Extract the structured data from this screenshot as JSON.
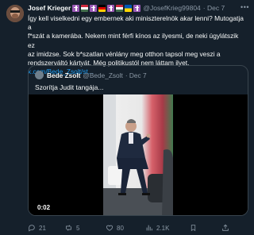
{
  "tweet": {
    "author_name": "Josef Krieger",
    "author_handle": "@JosefKrieg99804",
    "time": "· Dec 7",
    "body_lines": [
      "Így kell viselkedni egy embernek aki miniszterelnök akar lenni?  Mutogatja a",
      "f*szát a kamerába. Nekem mint férfi kínos az ilyesmi, de neki úgylátszik ez",
      "az imidzse. Sok b*szatlan vénlány meg otthon tapsol meg veszi a",
      "rendszerváltó kártyát. Még politikustól nem láttam ilyet."
    ],
    "link": "x.com/Bede_Zsolt/st...",
    "more_icon": "more-icon"
  },
  "quote": {
    "author_name": "Bede Zsolt",
    "author_handle": "@Bede_Zsolt",
    "time": "· Dec 7",
    "text": "Szorítja Judit tangája...",
    "video_duration": "0:02"
  },
  "actions": {
    "replies": "21",
    "reposts": "5",
    "likes": "80",
    "views": "2.1K"
  },
  "colors": {
    "background": "#15202b",
    "text": "#f7f9f9",
    "muted": "#8b98a5",
    "link": "#1d9bf0",
    "border": "#38444d"
  }
}
